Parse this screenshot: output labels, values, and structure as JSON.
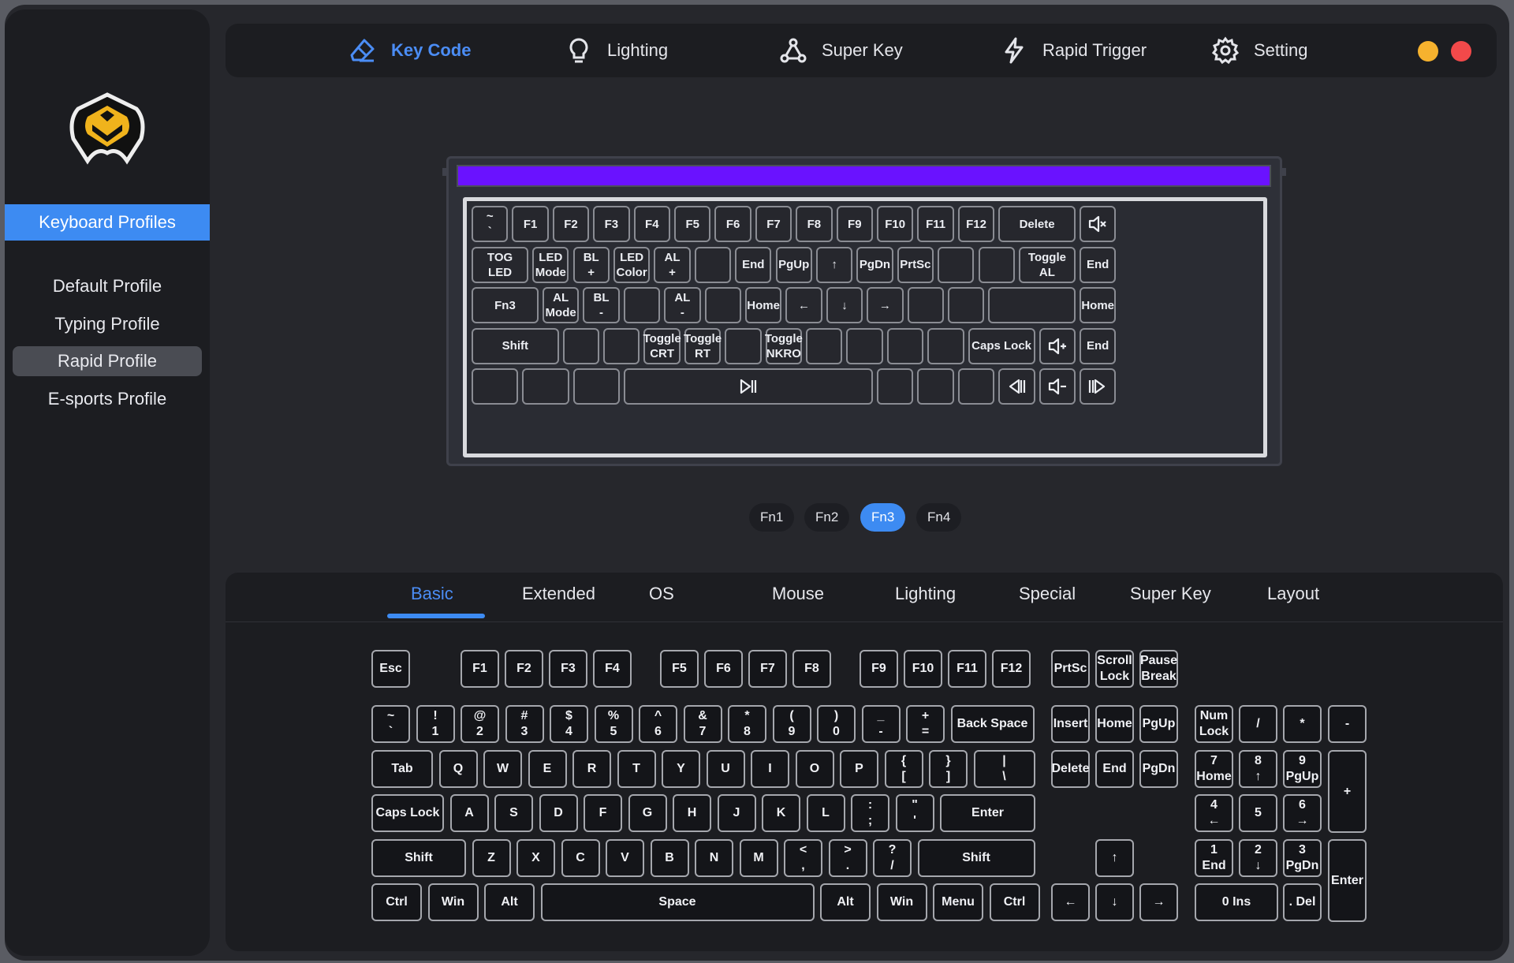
{
  "sidebar": {
    "header": "Keyboard Profiles",
    "profiles": [
      "Default Profile",
      "Typing Profile",
      "Rapid Profile",
      "E-sports Profile"
    ],
    "selected_index": 2
  },
  "nav": {
    "tabs": [
      {
        "label": "Key Code",
        "icon": "eraser-icon",
        "active": true
      },
      {
        "label": "Lighting",
        "icon": "bulb-icon",
        "active": false
      },
      {
        "label": "Super Key",
        "icon": "share-nodes-icon",
        "active": false
      },
      {
        "label": "Rapid Trigger",
        "icon": "lightning-icon",
        "active": false
      },
      {
        "label": "Setting",
        "icon": "gear-icon",
        "active": false
      }
    ],
    "window_controls": {
      "minimize_color": "#f6b22e",
      "close_color": "#f2494a"
    }
  },
  "colors": {
    "accent": "#3d8bf2",
    "light_bar": "#6a12ff"
  },
  "virtual_keyboard": {
    "rows": [
      [
        "~\n`",
        "F1",
        "F2",
        "F3",
        "F4",
        "F5",
        "F6",
        "F7",
        "F8",
        "F9",
        "F10",
        "F11",
        "F12",
        "Delete",
        "mute-icon"
      ],
      [
        "TOG\nLED",
        "LED\nMode",
        "BL\n+",
        "LED\nColor",
        "AL\n+",
        "",
        "End",
        "PgUp",
        "↑",
        "PgDn",
        "PrtSc",
        "",
        "",
        "Toggle\nAL",
        "End"
      ],
      [
        "Fn3",
        "AL\nMode",
        "BL\n-",
        "",
        "AL\n-",
        "",
        "Home",
        "←",
        "↓",
        "→",
        "",
        "",
        "",
        "Home"
      ],
      [
        "Shift",
        "",
        "",
        "Toggle\nCRT",
        "Toggle\nRT",
        "",
        "Toggle\nNKRO",
        "",
        "",
        "",
        "",
        "Caps Lock",
        "volume-up-icon",
        "End"
      ],
      [
        "",
        "",
        "",
        "play-pause-icon",
        "",
        "",
        "",
        "prev-track-icon",
        "volume-down-icon",
        "next-track-icon"
      ]
    ]
  },
  "fn_layers": {
    "labels": [
      "Fn1",
      "Fn2",
      "Fn3",
      "Fn4"
    ],
    "active": "Fn3"
  },
  "keycode_tabs": {
    "labels": [
      "Basic",
      "Extended",
      "OS",
      "Mouse",
      "Lighting",
      "Special",
      "Super Key",
      "Layout"
    ],
    "active": "Basic"
  },
  "keys": {
    "fnrow": [
      "Esc",
      "F1",
      "F2",
      "F3",
      "F4",
      "F5",
      "F6",
      "F7",
      "F8",
      "F9",
      "F10",
      "F11",
      "F12",
      "PrtSc",
      "Scroll\nLock",
      "Pause\nBreak"
    ],
    "number_row": [
      "~\n`",
      "!\n1",
      "@\n2",
      "#\n3",
      "$\n4",
      "%\n5",
      "^\n6",
      "&\n7",
      "*\n8",
      "(\n9",
      ")\n0",
      "_\n-",
      "+\n=",
      "Back Space"
    ],
    "tab_row": [
      "Tab",
      "Q",
      "W",
      "E",
      "R",
      "T",
      "Y",
      "U",
      "I",
      "O",
      "P",
      "{\n[",
      "}\n]",
      "|\n\\"
    ],
    "caps_row": [
      "Caps Lock",
      "A",
      "S",
      "D",
      "F",
      "G",
      "H",
      "J",
      "K",
      "L",
      ":\n;",
      "\"\n'",
      "Enter"
    ],
    "shift_row": [
      "Shift",
      "Z",
      "X",
      "C",
      "V",
      "B",
      "N",
      "M",
      "<\n,",
      ">\n.",
      "?\n/",
      "Shift"
    ],
    "bottom_row": [
      "Ctrl",
      "Win",
      "Alt",
      "Space",
      "Alt",
      "Win",
      "Menu",
      "Ctrl"
    ],
    "nav_cluster": [
      "Insert",
      "Home",
      "PgUp",
      "Delete",
      "End",
      "PgDn",
      "↑",
      "←",
      "↓",
      "→"
    ],
    "numpad": [
      "Num\nLock",
      "/",
      "*",
      "-",
      "7\nHome",
      "8\n↑",
      "9\nPgUp",
      "+",
      "4\n←",
      "5",
      "6\n→",
      "1\nEnd",
      "2\n↓",
      "3\nPgDn",
      "Enter",
      "0 Ins",
      ". Del"
    ]
  }
}
